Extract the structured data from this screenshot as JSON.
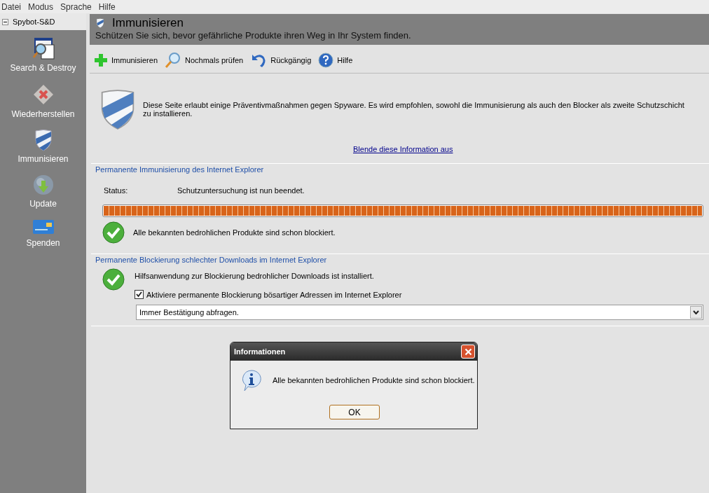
{
  "menu": [
    "Datei",
    "Modus",
    "Sprache",
    "Hilfe"
  ],
  "sidebar": {
    "title": "Spybot-S&D",
    "items": [
      {
        "label": "Search & Destroy",
        "kind": "search"
      },
      {
        "label": "Wiederherstellen",
        "kind": "restore"
      },
      {
        "label": "Immunisieren",
        "kind": "shield"
      },
      {
        "label": "Update",
        "kind": "update"
      },
      {
        "label": "Spenden",
        "kind": "card"
      }
    ]
  },
  "header": {
    "title": "Immunisieren",
    "subtitle": "Schützen Sie sich, bevor gefährliche Produkte ihren Weg in Ihr System finden."
  },
  "toolbar": [
    {
      "label": "Immunisieren",
      "kind": "plus"
    },
    {
      "label": "Nochmals prüfen",
      "kind": "search"
    },
    {
      "label": "Rückgängig",
      "kind": "undo"
    },
    {
      "label": "Hilfe",
      "kind": "help"
    }
  ],
  "info": {
    "text": "Diese Seite erlaubt einige Präventivmaßnahmen gegen Spyware. Es wird empfohlen, sowohl die Immunisierung als auch den Blocker als zweite Schutzschicht zu installieren.",
    "link": "Blende diese Information aus"
  },
  "immunization": {
    "title": "Permanente Immunisierung des Internet Explorer",
    "status_label": "Status:",
    "status": "Schutzuntersuchung ist nun beendet.",
    "progress": {
      "level": 1
    },
    "result": "Alle bekannten bedrohlichen Produkte sind schon blockiert."
  },
  "blocking": {
    "title": "Permanente Blockierung schlechter Downloads im Internet Explorer",
    "result": "Hilfsanwendung zur Blockierung bedrohlicher Downloads ist installiert.",
    "checkbox": {
      "label": "Aktiviere permanente Blockierung bösartiger Adressen im Internet Explorer",
      "checked": true
    },
    "dropdown": {
      "value": "Immer Bestätigung abfragen."
    }
  },
  "dialog": {
    "title": "Informationen",
    "message": "Alle bekannten bedrohlichen Produkte sind schon blockiert.",
    "button": "OK"
  }
}
